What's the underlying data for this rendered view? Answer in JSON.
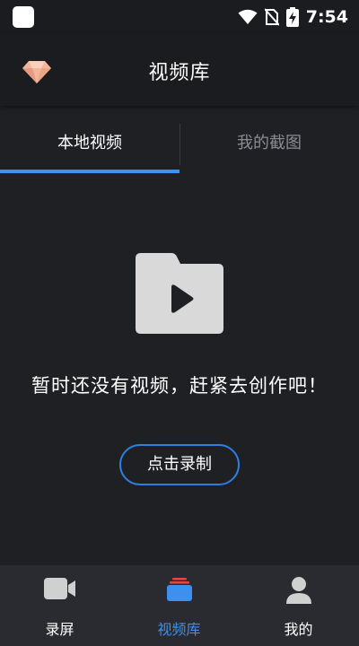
{
  "status_bar": {
    "time": "7:54"
  },
  "header": {
    "title": "视频库",
    "vip_icon": "diamond-icon"
  },
  "tabs": [
    {
      "label": "本地视频",
      "selected": true
    },
    {
      "label": "我的截图",
      "selected": false
    }
  ],
  "empty_state": {
    "icon": "folder-play-icon",
    "message": "暂时还没有视频，赶紧去创作吧！",
    "button_label": "点击录制"
  },
  "bottom_nav": [
    {
      "label": "录屏",
      "icon": "camera-icon",
      "active": false
    },
    {
      "label": "视频库",
      "icon": "library-icon",
      "active": true
    },
    {
      "label": "我的",
      "icon": "person-icon",
      "active": false
    }
  ],
  "colors": {
    "accent": "#3c93f0",
    "background": "#1f2024",
    "nav_background": "#2a2b30"
  }
}
